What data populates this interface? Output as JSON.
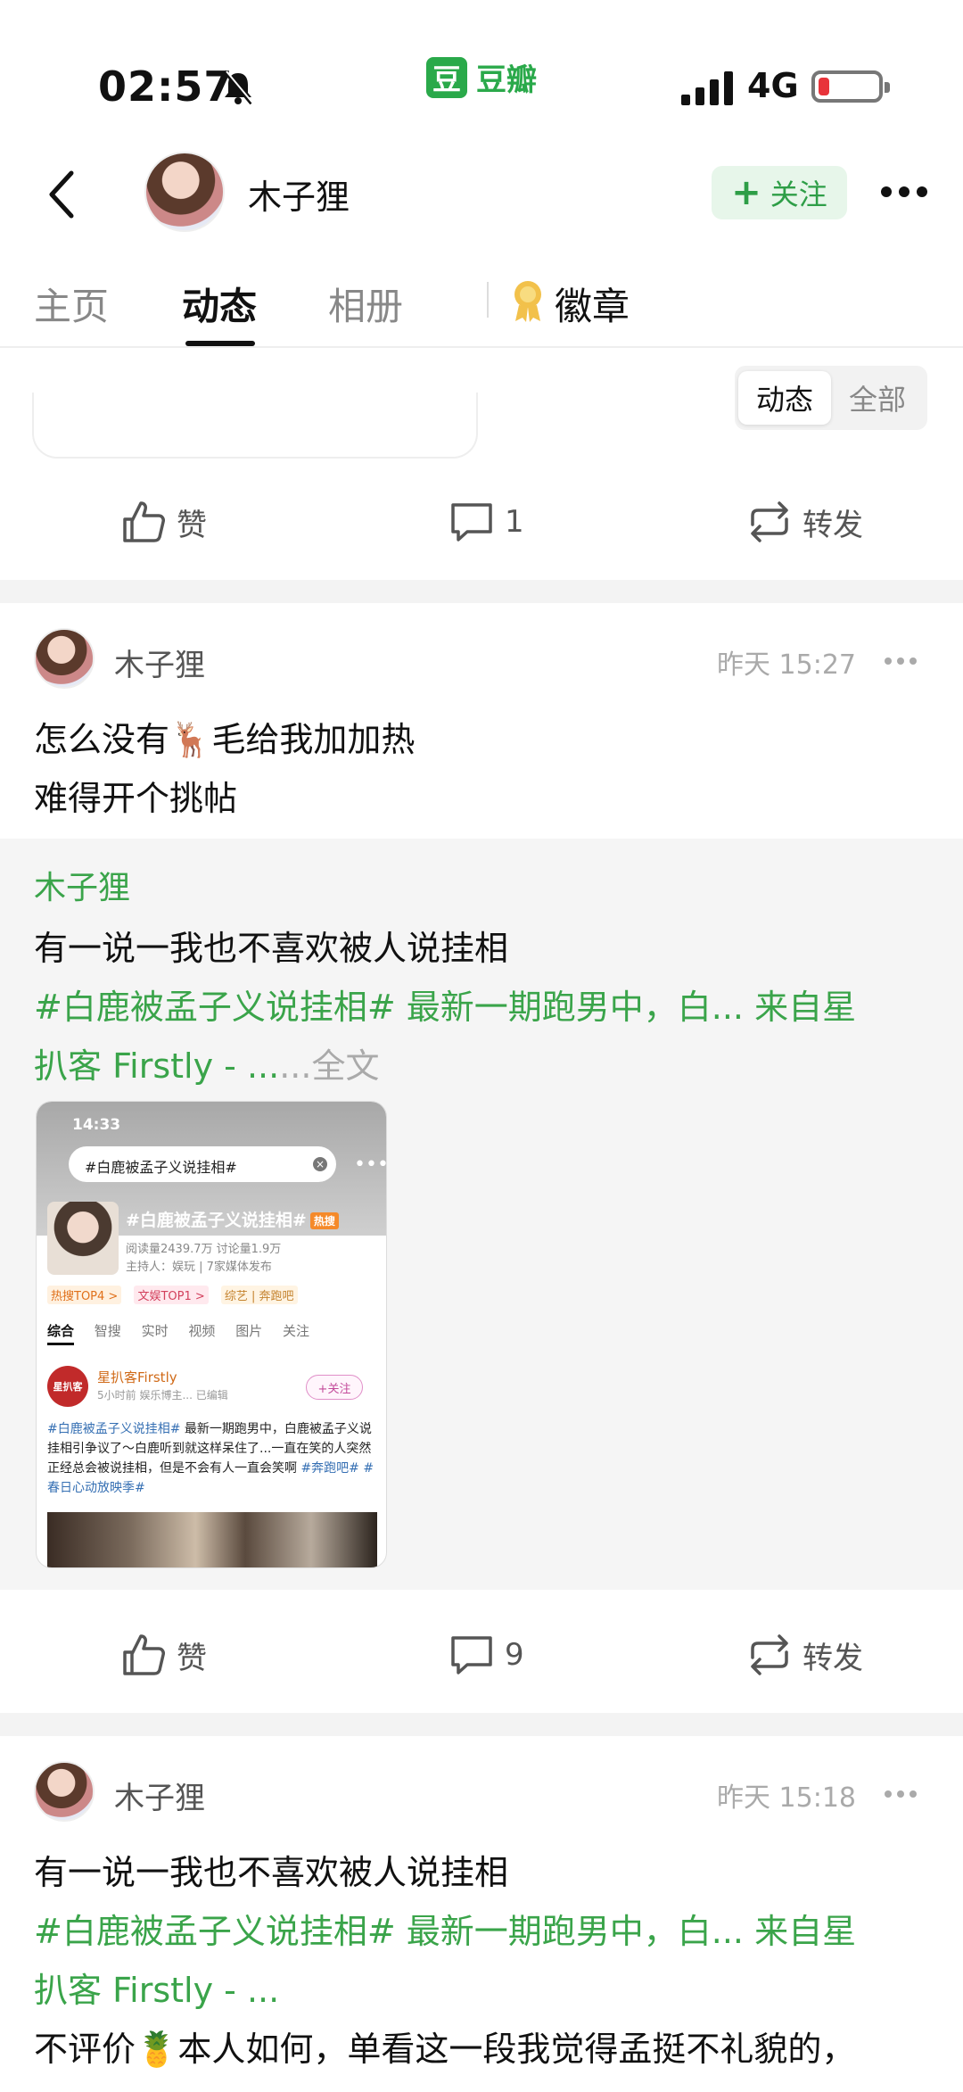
{
  "status_bar": {
    "time": "02:57",
    "app_name": "豆瓣",
    "app_logo": "豆",
    "network": "4G",
    "battery_color": "#e8333a"
  },
  "header": {
    "user_name": "木子狸",
    "follow_label": "关注",
    "follow_plus": "+"
  },
  "tabs": {
    "home": "主页",
    "activity": "动态",
    "album": "相册",
    "badges": "徽章"
  },
  "filter": {
    "selected": "动态",
    "other": "全部"
  },
  "action_bar_1": {
    "like": "赞",
    "comments": "1",
    "repost": "转发"
  },
  "post1": {
    "author": "木子狸",
    "time": "昨天 15:27",
    "text_line1_a": "怎么没有",
    "text_line1_emoji": "🦌",
    "text_line1_b": "毛给我加加热",
    "text_line2": "难得开个挑帖",
    "repost": {
      "author": "木子狸",
      "text": "有一说一我也不喜欢被人说挂相",
      "link_line1": "#白鹿被孟子义说挂相# 最新一期跑男中，白... 来自星",
      "link_line2": "扒客 Firstly - ...",
      "more_label": "...全文"
    }
  },
  "embedded_screenshot": {
    "time": "14:33",
    "search_text": "#白鹿被孟子义说挂相#",
    "topic_title": "#白鹿被孟子义说挂相#",
    "hot_label": "热搜",
    "stats": "阅读量2439.7万  讨论量1.9万",
    "host": "主持人：娱玩 | 7家媒体发布",
    "tags": [
      "热搜TOP4 >",
      "文娱TOP1 >",
      "综艺 | 奔跑吧"
    ],
    "tabs": [
      "综合",
      "智搜",
      "实时",
      "视频",
      "图片",
      "关注"
    ],
    "uploader": "星扒客Firstly",
    "uploader_avatar": "星扒客",
    "uploader_meta": "5小时前  娱乐博主... 已编辑",
    "uploader_follow": "+关注",
    "body_tag": "#白鹿被孟子义说挂相#",
    "body_text": " 最新一期跑男中，白鹿被孟子义说挂相引争议了～白鹿听到就这样呆住了...一直在笑的人突然正经总会被说挂相，但是不会有人一直会笑啊",
    "body_tags_end": "#奔跑吧# #春日心动放映季#"
  },
  "action_bar_2": {
    "like": "赞",
    "comments": "9",
    "repost": "转发"
  },
  "post2": {
    "author": "木子狸",
    "time": "昨天 15:18",
    "text": "有一说一我也不喜欢被人说挂相",
    "link_line1": "#白鹿被孟子义说挂相# 最新一期跑男中，白... 来自星",
    "link_line2": "扒客 Firstly - ...",
    "text_line4_a": "不评价",
    "text_line4_emoji": "🍍",
    "text_line4_b": "本人如何，单看这一段我觉得孟挺不礼貌的，"
  },
  "colors": {
    "accent_green": "#3aa44a",
    "follow_bg": "#e7f6ea",
    "separator": "#f3f3f3"
  }
}
